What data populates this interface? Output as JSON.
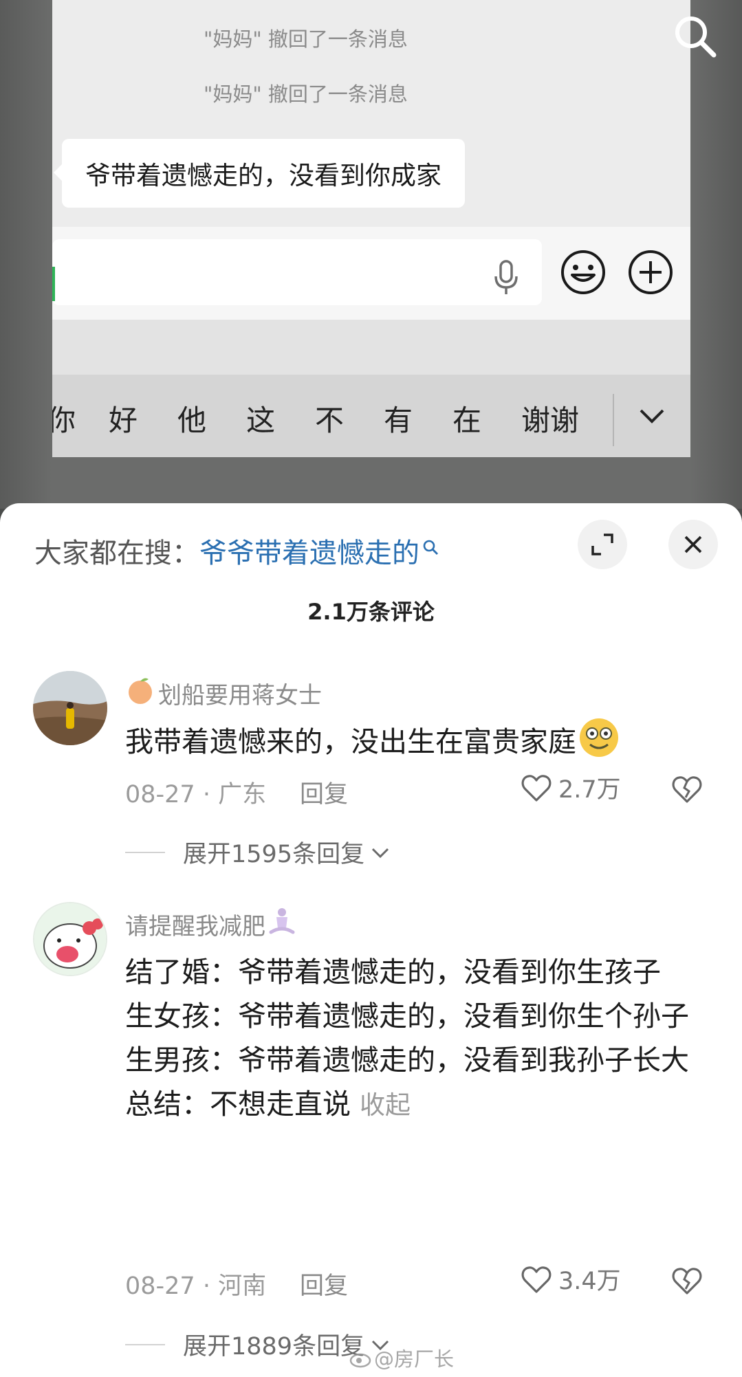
{
  "chat_screenshot": {
    "recall_1": "\"妈妈\" 撤回了一条消息",
    "recall_2": "\"妈妈\" 撤回了一条消息",
    "message": "爷带着遗憾走的，没看到你成家",
    "candidates": [
      "你",
      "好",
      "他",
      "这",
      "不",
      "有",
      "在",
      "谢谢"
    ]
  },
  "sheet": {
    "hot_prefix": "大家都在搜：",
    "hot_term": "爷爷带着遗憾走的",
    "comment_count": "2.1万条评论"
  },
  "comments": [
    {
      "username": "划船要用蒋女士",
      "text": "我带着遗憾来的，没出生在富贵家庭",
      "date_location": "08-27 · 广东",
      "reply_label": "回复",
      "likes": "2.7万",
      "expand_label": "展开1595条回复"
    },
    {
      "username": "请提醒我减肥",
      "lines": [
        "结了婚：爷带着遗憾走的，没看到你生孩子",
        "生女孩：爷带着遗憾走的，没看到你生个孙子",
        "生男孩：爷带着遗憾走的，没看到我孙子长大",
        "总结：不想走直说"
      ],
      "collapse_label": "收起",
      "date_location": "08-27 · 河南",
      "reply_label": "回复",
      "likes": "3.4万",
      "expand_label": "展开1889条回复"
    }
  ],
  "watermark": "@房厂长",
  "colors": {
    "hot_term": "#2a6fb1",
    "chat_bg": "#ededed",
    "sheet_bg": "#ffffff"
  }
}
